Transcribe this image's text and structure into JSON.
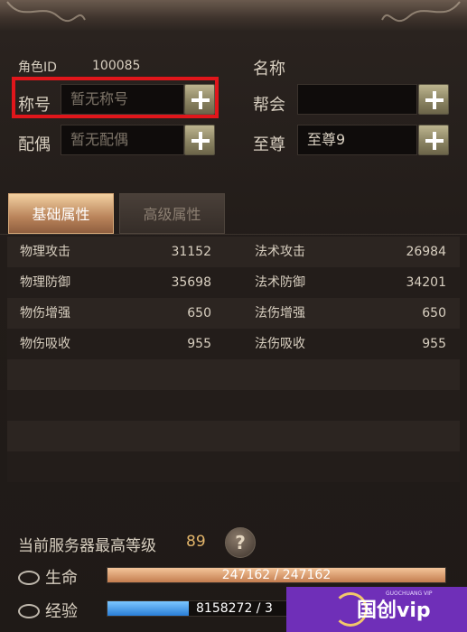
{
  "header": {
    "role_id_label": "角色ID",
    "role_id_value": "100085",
    "name_label": "名称"
  },
  "fields": {
    "title_label": "称号",
    "title_placeholder": "暂无称号",
    "guild_label": "帮会",
    "spouse_label": "配偶",
    "spouse_placeholder": "暂无配偶",
    "supreme_label": "至尊",
    "supreme_value": "至尊9"
  },
  "tabs": [
    {
      "label": "基础属性",
      "active": true
    },
    {
      "label": "高级属性",
      "active": false
    }
  ],
  "attributes": [
    {
      "left_name": "物理攻击",
      "left_value": "31152",
      "right_name": "法术攻击",
      "right_value": "26984"
    },
    {
      "left_name": "物理防御",
      "left_value": "35698",
      "right_name": "法术防御",
      "right_value": "34201"
    },
    {
      "left_name": "物伤增强",
      "left_value": "650",
      "right_name": "法伤增强",
      "right_value": "650"
    },
    {
      "left_name": "物伤吸收",
      "left_value": "955",
      "right_name": "法伤吸收",
      "right_value": "955"
    }
  ],
  "server": {
    "max_level_label": "当前服务器最高等级",
    "max_level_value": "89",
    "help_symbol": "?"
  },
  "bars": {
    "hp_label": "生命",
    "hp_text": "247162 / 247162",
    "hp_fraction": 1.0,
    "exp_label": "经验",
    "exp_text": "8158272 / 3"
  },
  "watermark": {
    "text": "国创vip",
    "small_text": "GUOCHUANG VIP"
  },
  "colors": {
    "highlight_border": "#e0161b",
    "hp_fill": "#e7a977",
    "exp_fill": "#2d8fe0",
    "watermark_bg": "#6f2fb8"
  }
}
